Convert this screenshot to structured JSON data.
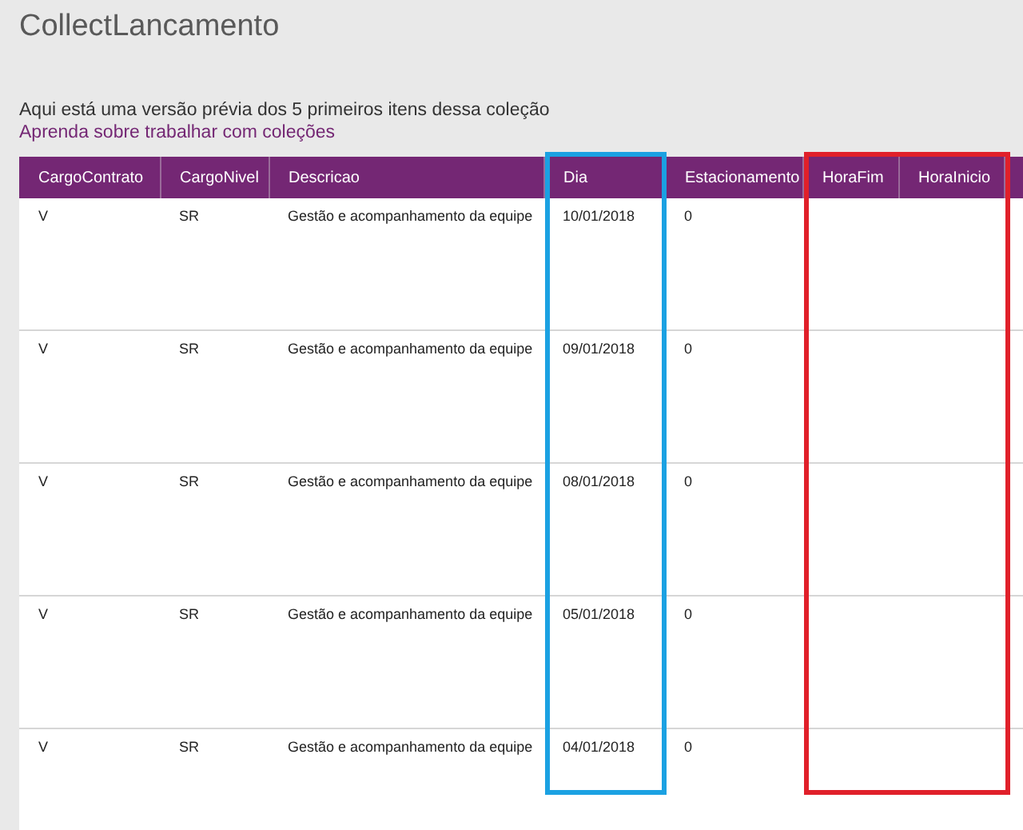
{
  "title": "CollectLancamento",
  "intro": "Aqui está uma versão prévia dos 5 primeiros itens dessa coleção",
  "link": "Aprenda sobre trabalhar com coleções",
  "table": {
    "columns": [
      {
        "label": "CargoContrato"
      },
      {
        "label": "CargoNivel"
      },
      {
        "label": "Descricao"
      },
      {
        "label": "Dia",
        "color": "#1ba1e2"
      },
      {
        "label": "Estacionamento"
      },
      {
        "label": "HoraFim",
        "color": "#e0202a"
      },
      {
        "label": "HoraInicio",
        "color": "#e0202a"
      }
    ],
    "rows": [
      [
        "V",
        "SR",
        "Gestão e acompanhamento da equipe",
        "10/01/2018",
        "0"
      ],
      [
        "V",
        "SR",
        "Gestão e acompanhamento da equipe",
        "09/01/2018",
        "0"
      ],
      [
        "V",
        "SR",
        "Gestão e acompanhamento da equipe",
        "08/01/2018",
        "0"
      ],
      [
        "V",
        "SR",
        "Gestão e acompanhamento da equipe",
        "05/01/2018",
        "0"
      ],
      [
        "V",
        "SR",
        "Gestão e acompanhamento da equipe",
        "04/01/2018",
        "0"
      ]
    ]
  }
}
